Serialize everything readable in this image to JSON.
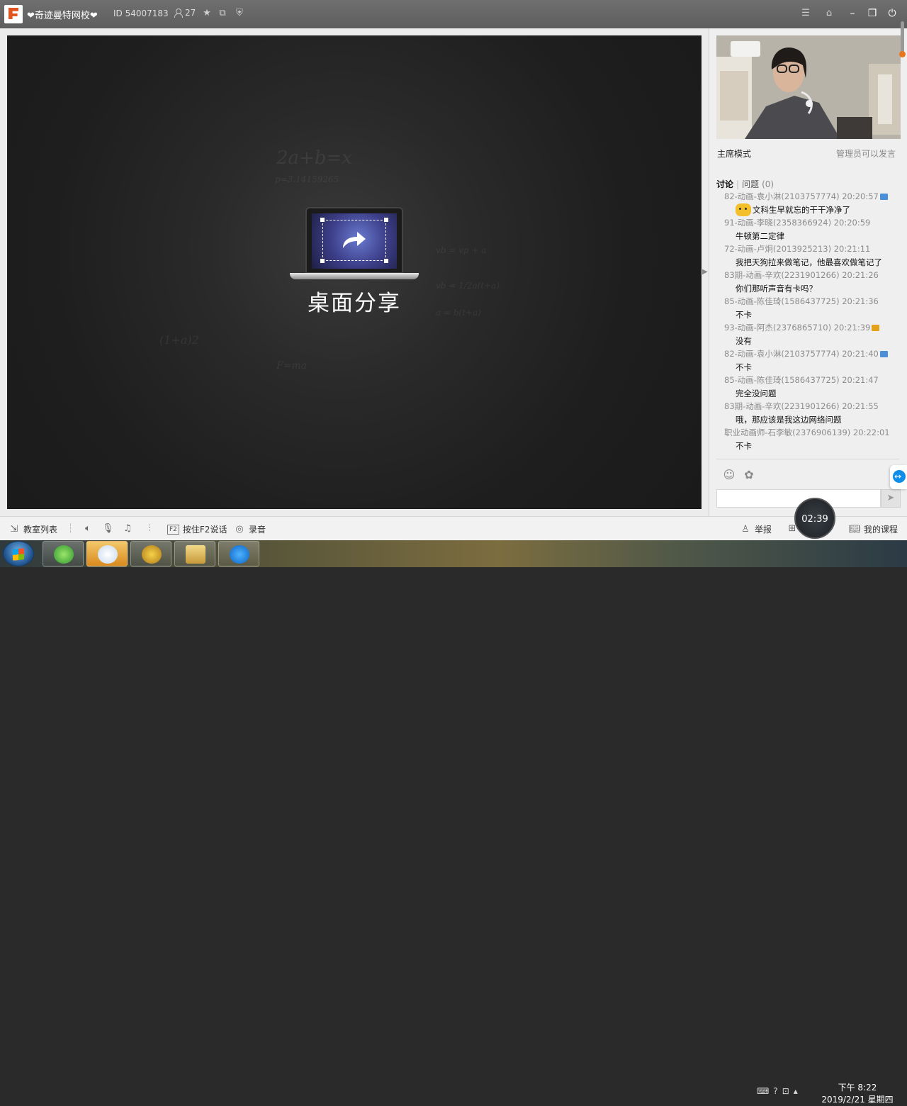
{
  "window": {
    "room_name": "❤奇迹曼特网校❤",
    "room_id": "ID 54007183",
    "online_count": "27",
    "controls": [
      "menu-icon",
      "skin-icon",
      "minimize-icon",
      "restore-icon",
      "power-icon"
    ]
  },
  "stage": {
    "share_label": "桌面分享",
    "chalk": [
      "2a+b=x",
      "p=3.14159265",
      "vb = vp + a",
      "vb = 1/2a(t+a)",
      "a = b(t+a)",
      "(1+a)2",
      "F=ma"
    ]
  },
  "panel": {
    "mode_label": "主席模式",
    "admin_label": "管理员可以发言",
    "tabs": {
      "discuss": "讨论",
      "question": "问题",
      "question_count": "(0)"
    },
    "messages": [
      {
        "header": "82-动画-袁小淋(2103757774) 20:20:57",
        "badge": "#4a8fd8",
        "body": "文科生早就忘的干干净净了",
        "emoji": true
      },
      {
        "header": "91-动画-李晓(2358366924) 20:20:59",
        "badge": "",
        "body": "牛顿第二定律",
        "emoji": false
      },
      {
        "header": "72-动画-卢炯(2013925213) 20:21:11",
        "badge": "",
        "body": "我把天狗拉来做笔记，他最喜欢做笔记了",
        "emoji": false
      },
      {
        "header": "83期-动画-辛欢(2231901266) 20:21:26",
        "badge": "",
        "body": "你们那听声音有卡吗？",
        "emoji": false
      },
      {
        "header": "85-动画-陈佳琦(1586437725) 20:21:36",
        "badge": "",
        "body": "不卡",
        "emoji": false
      },
      {
        "header": "93-动画-阿杰(2376865710) 20:21:39",
        "badge": "#e2a21a",
        "body": "没有",
        "emoji": false
      },
      {
        "header": "82-动画-袁小淋(2103757774) 20:21:40",
        "badge": "#4a8fd8",
        "body": "不卡",
        "emoji": false
      },
      {
        "header": "85-动画-陈佳琦(1586437725) 20:21:47",
        "badge": "",
        "body": "完全没问题",
        "emoji": false
      },
      {
        "header": "83期-动画-辛欢(2231901266) 20:21:55",
        "badge": "",
        "body": "哦，那应该是我这边网络问题",
        "emoji": false
      },
      {
        "header": "职业动画师-石李敏(2376906139) 20:22:01",
        "badge": "",
        "body": "不卡",
        "emoji": false
      }
    ],
    "input_placeholder": ""
  },
  "toolbar": {
    "classroom_list": "教室列表",
    "push_to_talk": "按住F2说话",
    "f2_key": "F2",
    "record": "录音",
    "report": "举报",
    "my_courses": "我的课程",
    "timer": "02:39"
  },
  "taskbar": {
    "time": "下午 8:22",
    "date": "2019/2/21 星期四"
  }
}
